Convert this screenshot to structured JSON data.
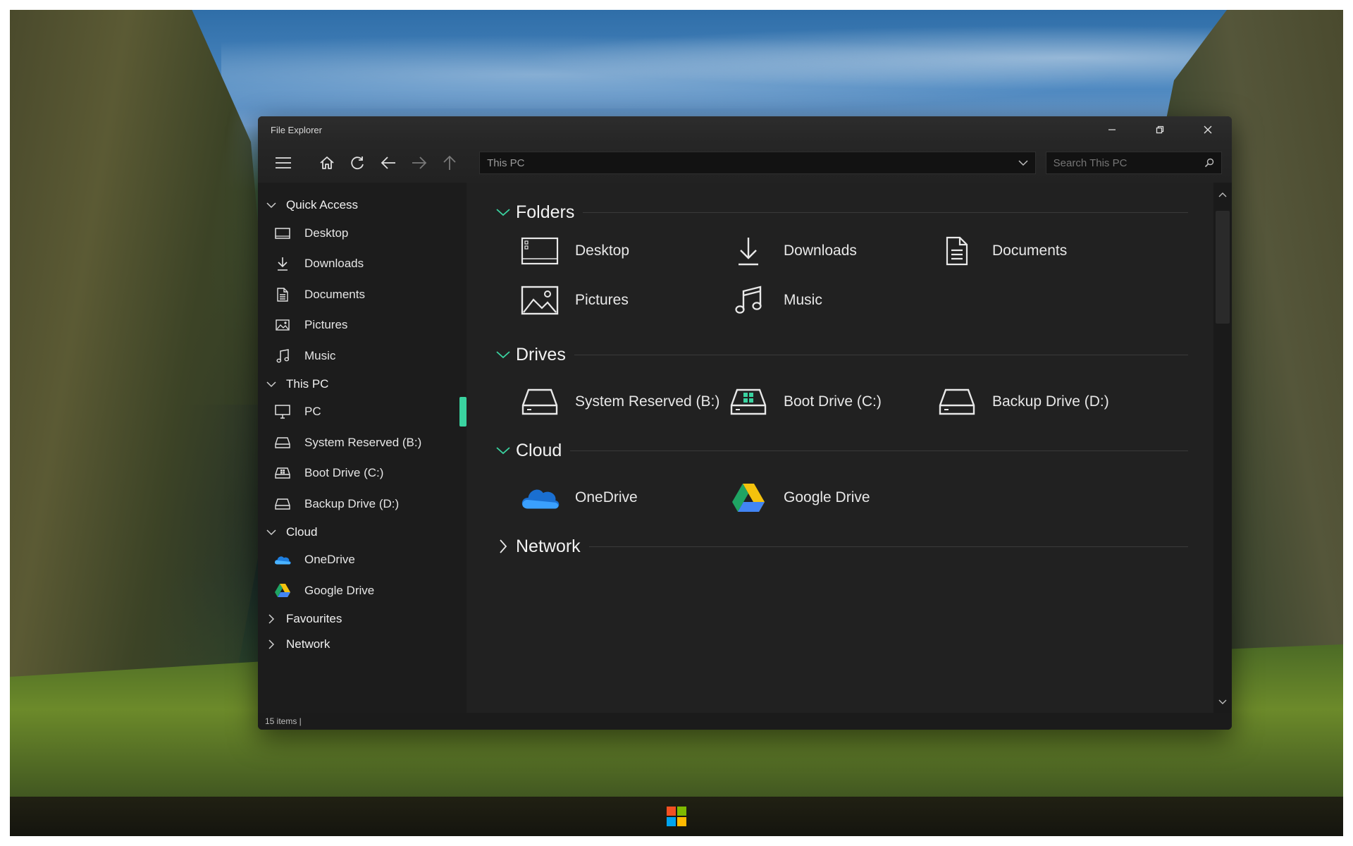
{
  "window": {
    "title": "File Explorer",
    "minimize_icon": "minimize-icon",
    "maximize_icon": "restore-icon",
    "close_icon": "close-icon"
  },
  "toolbar": {
    "address_value": "This PC",
    "search_placeholder": "Search This PC"
  },
  "sidebar": {
    "quick_access": {
      "label": "Quick Access",
      "items": [
        {
          "label": "Desktop",
          "icon": "desktop-icon"
        },
        {
          "label": "Downloads",
          "icon": "download-icon"
        },
        {
          "label": "Documents",
          "icon": "document-icon"
        },
        {
          "label": "Pictures",
          "icon": "picture-icon"
        },
        {
          "label": "Music",
          "icon": "music-icon"
        }
      ]
    },
    "this_pc": {
      "label": "This PC",
      "items": [
        {
          "label": "PC",
          "icon": "monitor-icon"
        },
        {
          "label": "System Reserved (B:)",
          "icon": "drive-icon"
        },
        {
          "label": "Boot Drive (C:)",
          "icon": "windows-drive-icon"
        },
        {
          "label": "Backup Drive (D:)",
          "icon": "drive-icon"
        }
      ]
    },
    "cloud": {
      "label": "Cloud",
      "items": [
        {
          "label": "OneDrive",
          "icon": "onedrive-icon"
        },
        {
          "label": "Google Drive",
          "icon": "google-drive-icon"
        }
      ]
    },
    "favourites": {
      "label": "Favourites"
    },
    "network": {
      "label": "Network"
    }
  },
  "main": {
    "folders": {
      "label": "Folders",
      "items": [
        {
          "label": "Desktop",
          "icon": "desktop-icon"
        },
        {
          "label": "Downloads",
          "icon": "download-icon"
        },
        {
          "label": "Documents",
          "icon": "document-icon"
        },
        {
          "label": "Pictures",
          "icon": "picture-icon"
        },
        {
          "label": "Music",
          "icon": "music-icon"
        }
      ]
    },
    "drives": {
      "label": "Drives",
      "items": [
        {
          "label": "System Reserved (B:)",
          "icon": "drive-icon"
        },
        {
          "label": "Boot Drive (C:)",
          "icon": "windows-drive-icon"
        },
        {
          "label": "Backup Drive (D:)",
          "icon": "drive-icon"
        }
      ]
    },
    "cloud": {
      "label": "Cloud",
      "items": [
        {
          "label": "OneDrive",
          "icon": "onedrive-icon"
        },
        {
          "label": "Google Drive",
          "icon": "google-drive-icon"
        }
      ]
    },
    "network": {
      "label": "Network"
    }
  },
  "status": {
    "items_count": "15 items |"
  },
  "colors": {
    "accent": "#3ad3a0",
    "window_bg": "#202020",
    "sidebar_bg": "#1c1c1c"
  }
}
